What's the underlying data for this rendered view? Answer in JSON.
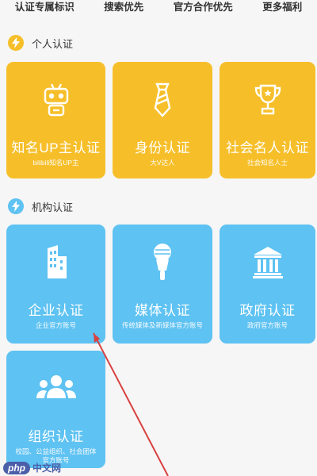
{
  "benefits": [
    "认证专属标识",
    "搜索优先",
    "官方合作优先",
    "更多福利"
  ],
  "sections": {
    "personal": {
      "title": "个人认证",
      "icon": "lightning-icon",
      "color": "#f6bf2a",
      "cards": [
        {
          "title": "知名UP主认证",
          "subtitle": "bilibili知名UP主",
          "icon": "tv-robot-icon"
        },
        {
          "title": "身份认证",
          "subtitle": "大V达人",
          "icon": "necktie-icon"
        },
        {
          "title": "社会名人认证",
          "subtitle": "社会知名人士",
          "icon": "trophy-icon"
        }
      ]
    },
    "organization": {
      "title": "机构认证",
      "icon": "lightning-icon",
      "color": "#5ec2f2",
      "cards": [
        {
          "title": "企业认证",
          "subtitle": "企业官方账号",
          "icon": "building-icon"
        },
        {
          "title": "媒体认证",
          "subtitle": "传统媒体及新媒体官方账号",
          "icon": "microphone-icon"
        },
        {
          "title": "政府认证",
          "subtitle": "政府官方账号",
          "icon": "government-icon"
        },
        {
          "title": "组织认证",
          "subtitle": "校园、公益组织、社会团体官方账号",
          "icon": "people-group-icon"
        }
      ]
    }
  },
  "watermark": {
    "logo": "php",
    "text": "中文网"
  }
}
